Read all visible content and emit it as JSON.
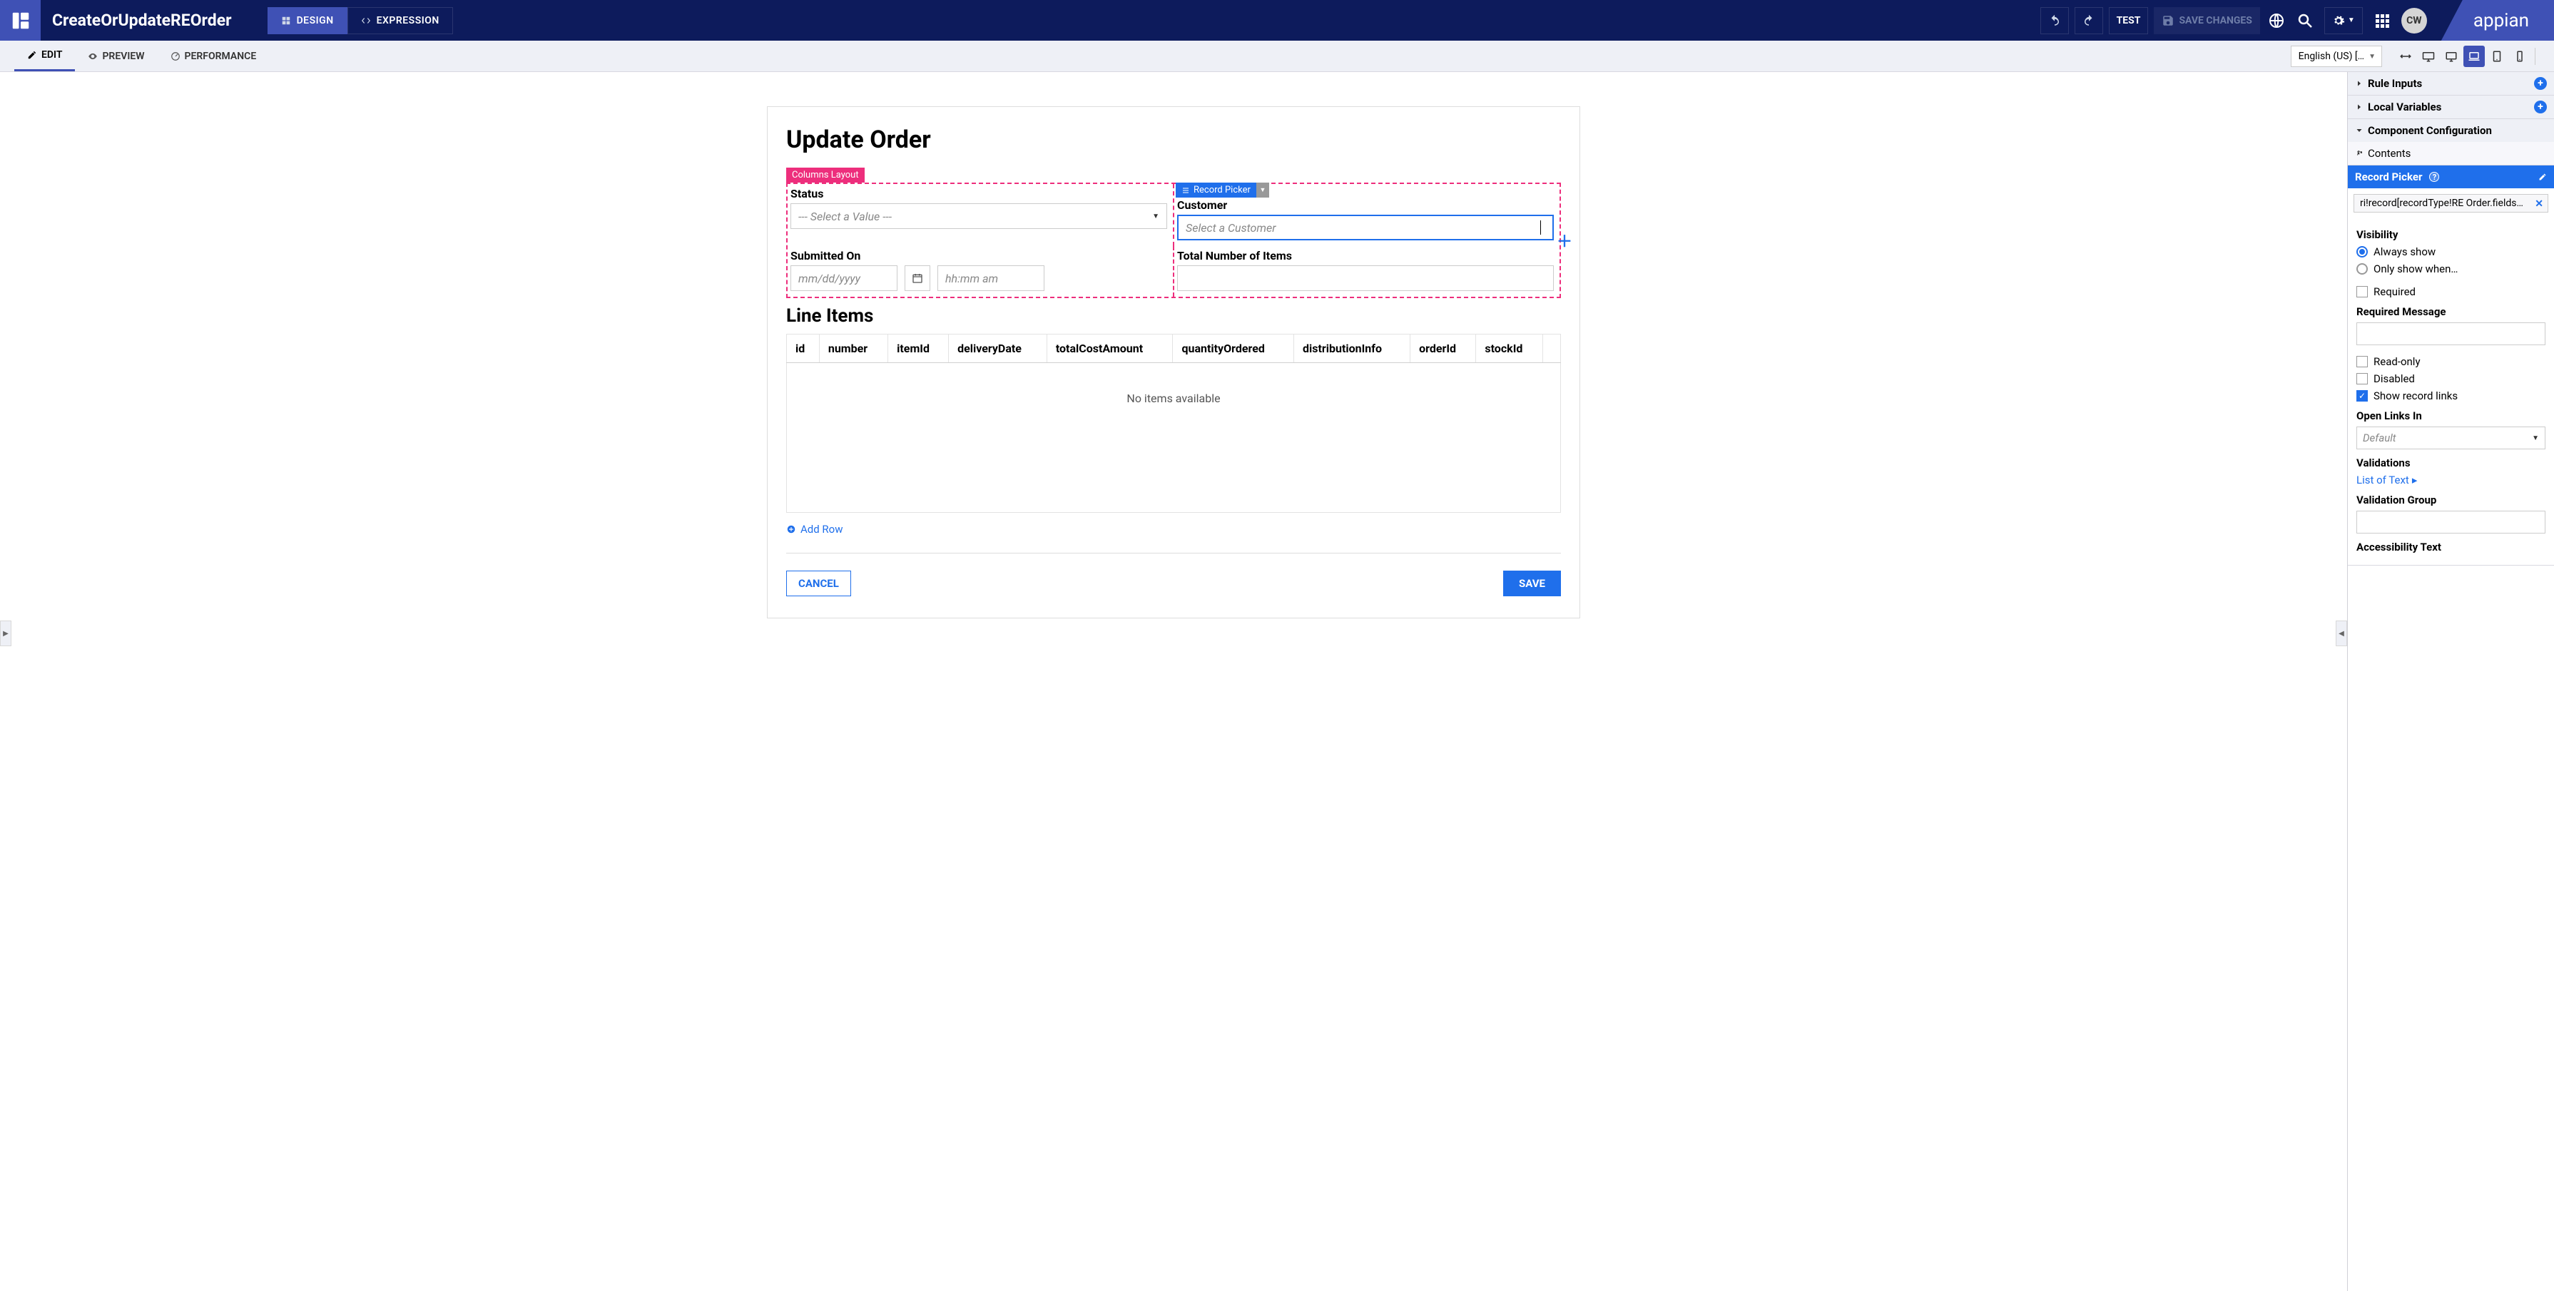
{
  "header": {
    "title": "CreateOrUpdateREOrder",
    "mode_design": "DESIGN",
    "mode_expression": "EXPRESSION",
    "test": "TEST",
    "save_changes": "SAVE CHANGES",
    "avatar": "CW",
    "logo": "appian"
  },
  "secondary": {
    "edit": "EDIT",
    "preview": "PREVIEW",
    "performance": "PERFORMANCE",
    "language": "English (US) […"
  },
  "form": {
    "title": "Update Order",
    "columns_tag": "Columns Layout",
    "record_picker_tag": "Record Picker",
    "status_label": "Status",
    "status_placeholder": "--- Select a Value ---",
    "customer_label": "Customer",
    "customer_placeholder": "Select a Customer",
    "submitted_label": "Submitted On",
    "date_placeholder": "mm/dd/yyyy",
    "time_placeholder": "hh:mm am",
    "total_label": "Total Number of Items",
    "line_items_title": "Line Items",
    "cols": {
      "c1": "id",
      "c2": "number",
      "c3": "itemId",
      "c4": "deliveryDate",
      "c5": "totalCostAmount",
      "c6": "quantityOrdered",
      "c7": "distributionInfo",
      "c8": "orderId",
      "c9": "stockId"
    },
    "no_items": "No items available",
    "add_row": "Add Row",
    "cancel": "CANCEL",
    "save": "SAVE"
  },
  "right": {
    "rule_inputs": "Rule Inputs",
    "local_vars": "Local Variables",
    "component_cfg": "Component Configuration",
    "contents": "Contents",
    "record_picker": "Record Picker",
    "chip": "ri!record[recordType!RE Order.fields…",
    "visibility": "Visibility",
    "always_show": "Always show",
    "only_show": "Only show when…",
    "required": "Required",
    "required_msg": "Required Message",
    "readonly": "Read-only",
    "disabled": "Disabled",
    "show_links": "Show record links",
    "open_links": "Open Links In",
    "open_links_default": "Default",
    "validations": "Validations",
    "list_of_text": "List of Text",
    "validation_group": "Validation Group",
    "accessibility": "Accessibility Text"
  }
}
